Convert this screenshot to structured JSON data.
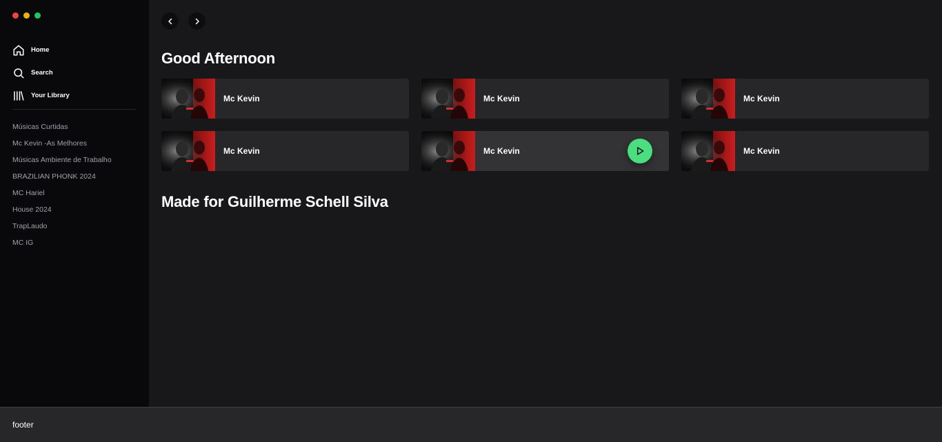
{
  "window": {
    "traffic_colors": [
      "#ef4444",
      "#eab308",
      "#22c55e"
    ]
  },
  "sidebar": {
    "nav": [
      {
        "label": "Home",
        "icon": "home-icon"
      },
      {
        "label": "Search",
        "icon": "search-icon"
      },
      {
        "label": "Your Library",
        "icon": "library-icon"
      }
    ],
    "playlists": [
      "Músicas Curtidas",
      "Mc Kevin -As Melhores",
      "Músicas Ambiente de Trabalho",
      "BRAZILIAN PHONK 2024",
      "MC Hariel",
      "House 2024",
      "TrapLaudo",
      "MC IG"
    ]
  },
  "main": {
    "greeting": "Good Afternoon",
    "cards": [
      {
        "title": "Mc Kevin"
      },
      {
        "title": "Mc Kevin"
      },
      {
        "title": "Mc Kevin"
      },
      {
        "title": "Mc Kevin"
      },
      {
        "title": "Mc Kevin",
        "hovered": true
      },
      {
        "title": "Mc Kevin"
      }
    ],
    "made_for": "Made for Guilherme Schell Silva"
  },
  "footer": {
    "text": "footer"
  },
  "colors": {
    "accent": "#4ade80",
    "sidebar_bg": "#09090b",
    "main_bg": "#18181b",
    "card_bg": "#27272a"
  }
}
